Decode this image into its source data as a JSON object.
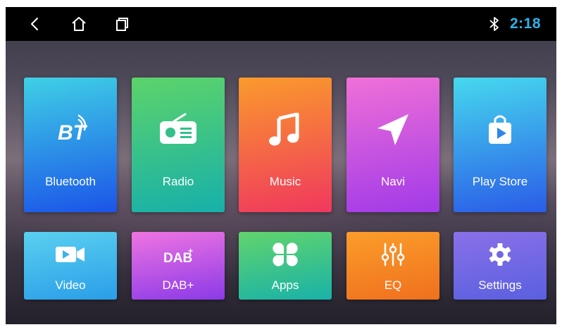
{
  "status_bar": {
    "time": "2:18",
    "icons": [
      "back-icon",
      "home-icon",
      "recent-apps-icon",
      "bluetooth-icon"
    ],
    "time_color": "#2db3ea"
  },
  "tiles": [
    {
      "label": "Bluetooth",
      "icon": "bluetooth-bt-icon",
      "colors": [
        "#39c9e6",
        "#1a48e6"
      ]
    },
    {
      "label": "Radio",
      "icon": "radio-icon",
      "colors": [
        "#5bd06a",
        "#1bb0a8"
      ]
    },
    {
      "label": "Music",
      "icon": "music-note-icon",
      "colors": [
        "#f8942c",
        "#f03a5c"
      ]
    },
    {
      "label": "Navi",
      "icon": "navigation-arrow-icon",
      "colors": [
        "#ee6fd6",
        "#a03ae8"
      ]
    },
    {
      "label": "Play Store",
      "icon": "shopping-bag-play-icon",
      "colors": [
        "#44d6ee",
        "#2a5ee6"
      ]
    },
    {
      "label": "Video",
      "icon": "video-camera-icon",
      "colors": [
        "#58cdf0",
        "#2a9ce8"
      ]
    },
    {
      "label": "DAB+",
      "icon": "dab-logo-icon",
      "dab_text": "DAB",
      "dab_sup": "+",
      "colors": [
        "#ee72e2",
        "#8b3ae8"
      ]
    },
    {
      "label": "Apps",
      "icon": "four-leaf-apps-icon",
      "colors": [
        "#5fd26e",
        "#1bb3a6"
      ]
    },
    {
      "label": "EQ",
      "icon": "equalizer-sliders-icon",
      "colors": [
        "#fa9a2a",
        "#f0731e"
      ]
    },
    {
      "label": "Settings",
      "icon": "gear-icon",
      "colors": [
        "#8a6ee8",
        "#5a5fe0"
      ]
    }
  ]
}
